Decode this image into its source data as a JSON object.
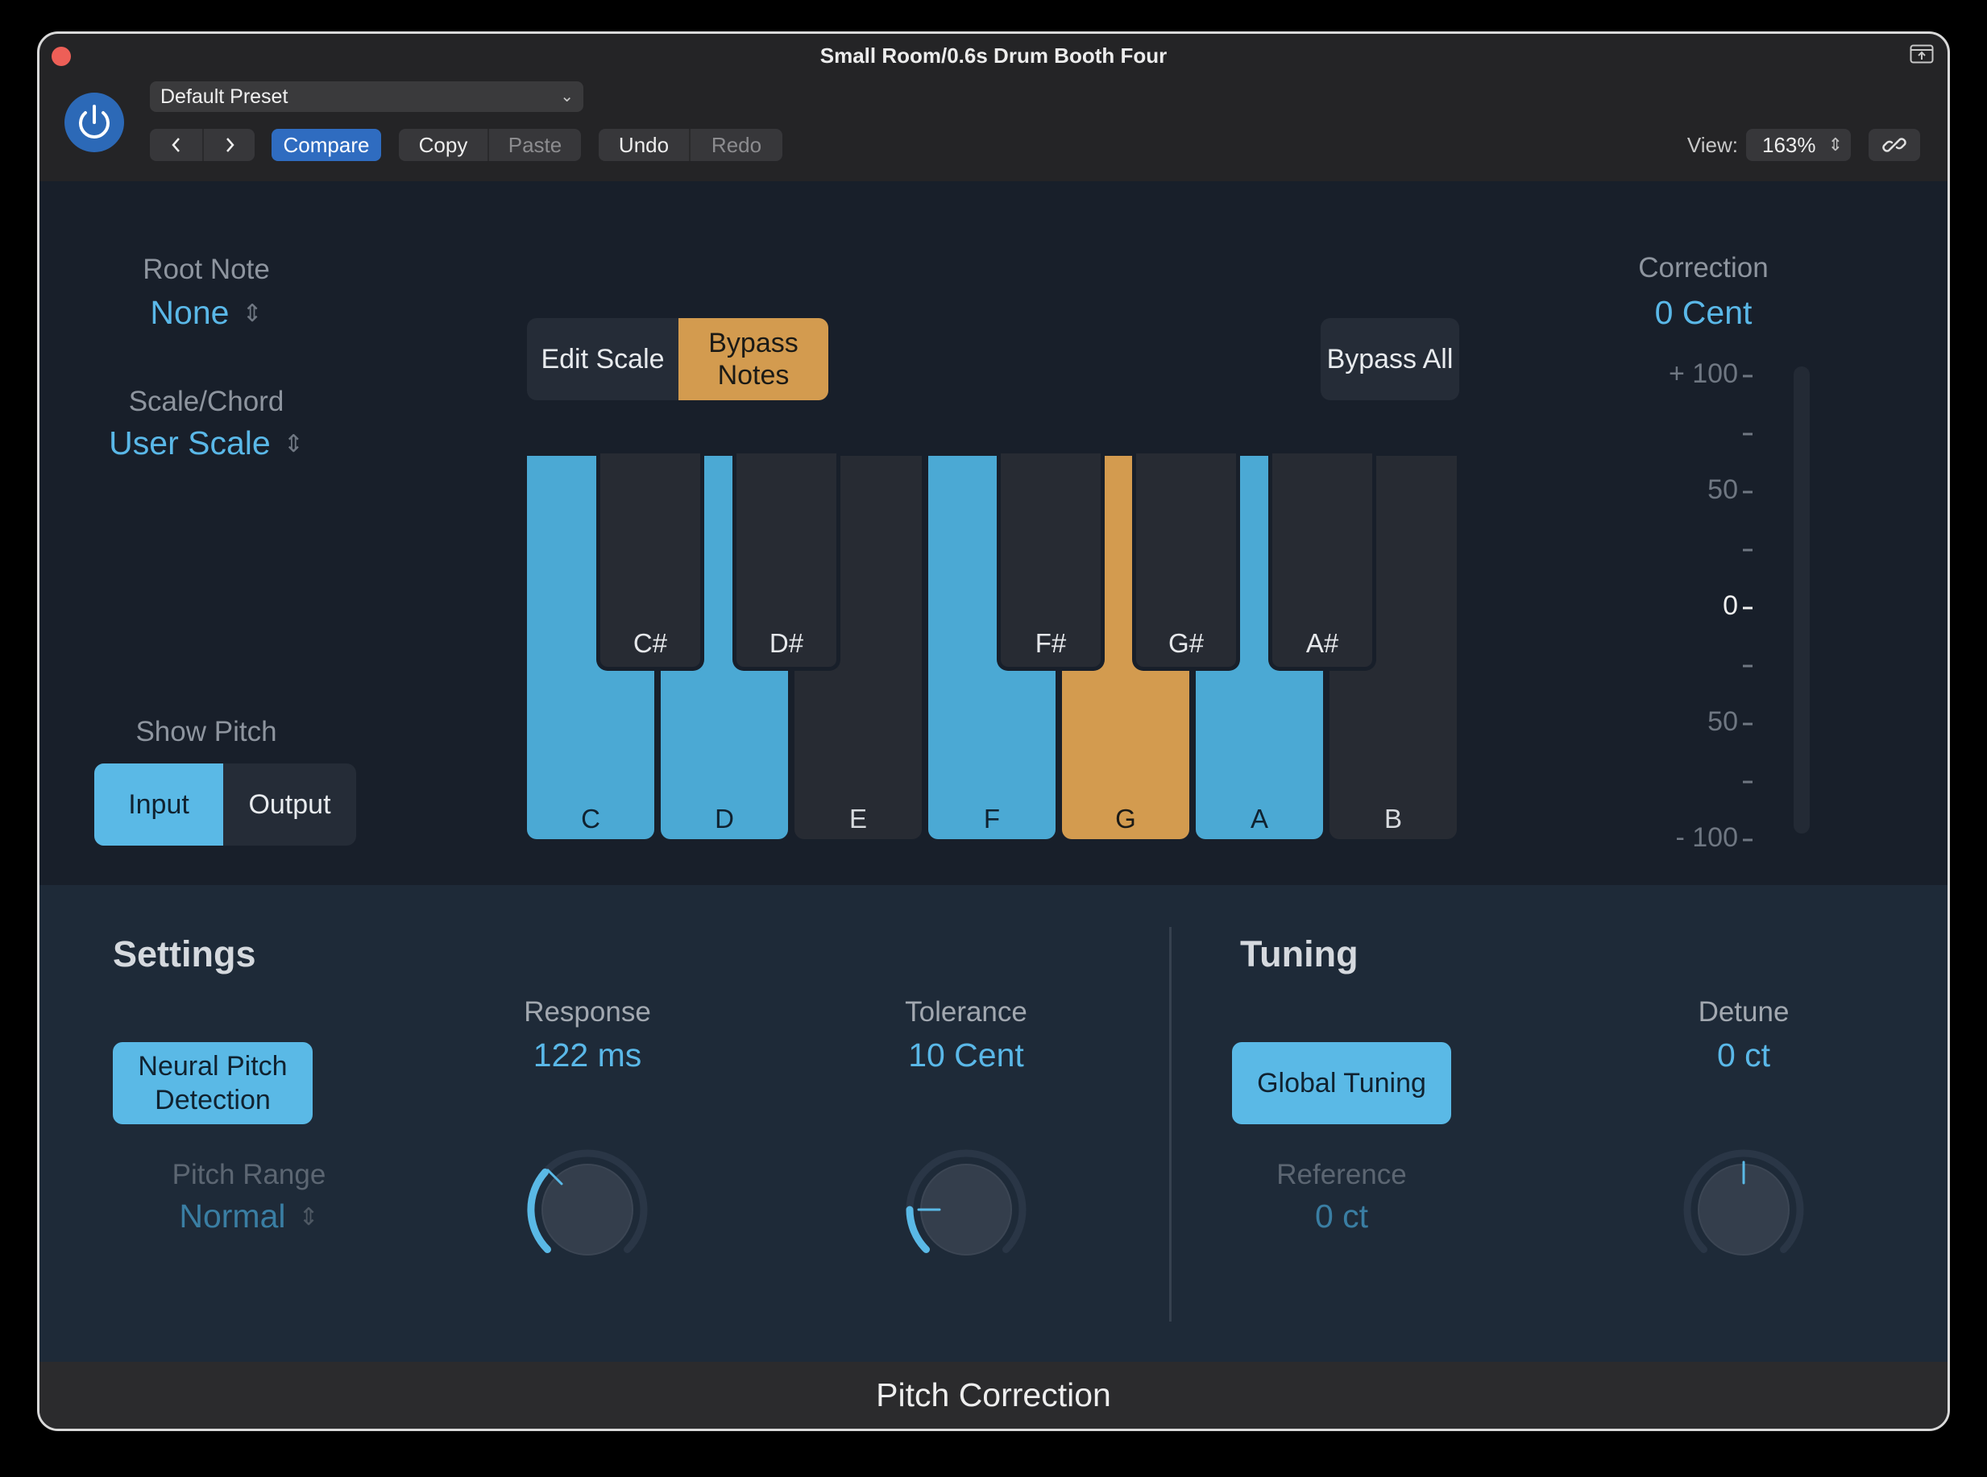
{
  "window": {
    "title": "Small Room/0.6s Drum Booth Four"
  },
  "toolbar": {
    "preset": "Default Preset",
    "prev_icon": "chevron-left-icon",
    "next_icon": "chevron-right-icon",
    "compare": "Compare",
    "copy": "Copy",
    "paste": "Paste",
    "undo": "Undo",
    "redo": "Redo",
    "view_label": "View:",
    "view_value": "163%"
  },
  "left": {
    "root_note_label": "Root Note",
    "root_note_value": "None",
    "scale_label": "Scale/Chord",
    "scale_value": "User Scale",
    "show_pitch_label": "Show Pitch",
    "input": "Input",
    "output": "Output",
    "selected": "Input"
  },
  "keyboard": {
    "edit_scale": "Edit Scale",
    "bypass_notes": "Bypass Notes",
    "bypass_all": "Bypass All",
    "white_keys": [
      {
        "note": "C",
        "state": "active"
      },
      {
        "note": "D",
        "state": "active"
      },
      {
        "note": "E",
        "state": "off"
      },
      {
        "note": "F",
        "state": "active"
      },
      {
        "note": "G",
        "state": "bypass"
      },
      {
        "note": "A",
        "state": "active"
      },
      {
        "note": "B",
        "state": "off"
      }
    ],
    "black_keys": [
      "C#",
      "D#",
      "F#",
      "G#",
      "A#"
    ]
  },
  "correction": {
    "label": "Correction",
    "value": "0 Cent",
    "ticks": [
      "+ 100",
      "50",
      "0",
      "50",
      "- 100"
    ]
  },
  "settings": {
    "title": "Settings",
    "neural": "Neural Pitch Detection",
    "pitch_range_label": "Pitch Range",
    "pitch_range_value": "Normal",
    "response_label": "Response",
    "response_value": "122 ms",
    "tolerance_label": "Tolerance",
    "tolerance_value": "10 Cent"
  },
  "tuning": {
    "title": "Tuning",
    "global": "Global Tuning",
    "reference_label": "Reference",
    "reference_value": "0 ct",
    "detune_label": "Detune",
    "detune_value": "0 ct"
  },
  "footer": "Pitch Correction",
  "colors": {
    "accent_blue": "#5ab9e6",
    "bypass_orange": "#d39b4f",
    "power_blue": "#2c69b7"
  }
}
